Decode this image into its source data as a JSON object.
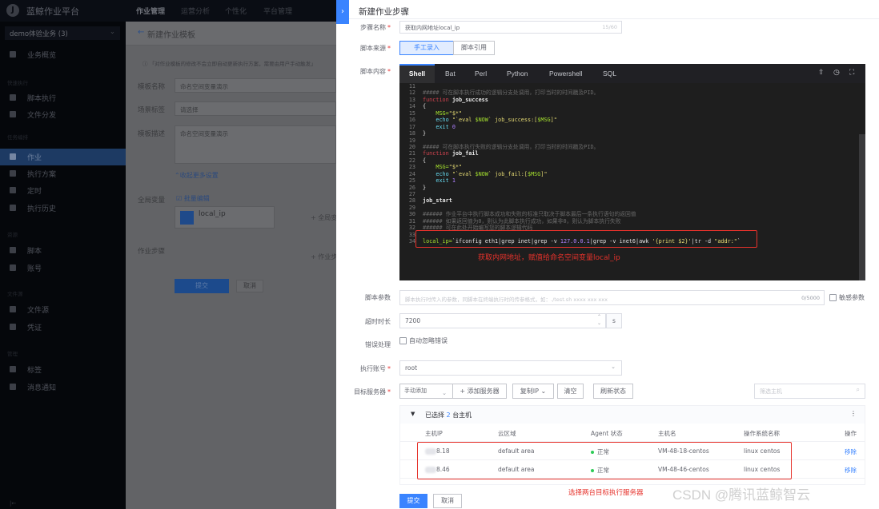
{
  "app": {
    "title": "蓝鲸作业平台",
    "logo_letter": "J",
    "top_nav": [
      "作业管理",
      "运营分析",
      "个性化",
      "平台管理"
    ],
    "business_selector": "demo体验业务 (3)"
  },
  "sidebar": {
    "items": [
      {
        "label": "业务概览"
      },
      {
        "group": "快速执行"
      },
      {
        "label": "脚本执行"
      },
      {
        "label": "文件分发"
      },
      {
        "group": "任务编排"
      },
      {
        "label": "作业",
        "active": true
      },
      {
        "label": "执行方案"
      },
      {
        "label": "定时"
      },
      {
        "label": "执行历史"
      },
      {
        "group": "资源"
      },
      {
        "label": "脚本"
      },
      {
        "label": "账号"
      },
      {
        "group": "文件源"
      },
      {
        "label": "文件源"
      },
      {
        "label": "凭证"
      },
      {
        "group": "管理"
      },
      {
        "label": "标签"
      },
      {
        "label": "消息通知"
      }
    ],
    "collapse_icon": "collapse-icon"
  },
  "background_page": {
    "title": "新建作业模板",
    "tip": "「对作业模板的修改不会立即自动更新执行方案，需要由用户手动触发」",
    "template_name_label": "模板名称",
    "template_name_value": "命名空间变量演示",
    "scene_tag_label": "场景标签",
    "scene_tag_placeholder": "请选择",
    "description_label": "模板描述",
    "description_value": "命名空间变量演示",
    "collapse_more": "收起更多设置",
    "global_var_label": "全局变量",
    "batch_edit": "批量编辑",
    "variable_name": "local_ip",
    "add_global": "+ 全局变",
    "steps_label": "作业步骤",
    "add_step": "+ 作业步",
    "submit": "提交",
    "cancel": "取消"
  },
  "drawer": {
    "title": "新建作业步骤",
    "step_name_label": "步骤名称",
    "step_name_value": "获取内网地址local_ip",
    "step_name_count": "15/60",
    "script_source_label": "脚本来源",
    "script_source_options": [
      "手工录入",
      "脚本引用"
    ],
    "script_source_selected": "手工录入",
    "script_content_label": "脚本内容",
    "language_tabs": [
      "Shell",
      "Bat",
      "Perl",
      "Python",
      "Powershell",
      "SQL"
    ],
    "language_selected": "Shell",
    "editor_icons": [
      "upload-icon",
      "history-icon",
      "fullscreen-icon"
    ],
    "code_lines": [
      {
        "n": "11",
        "segs": []
      },
      {
        "n": "12",
        "segs": [
          [
            "##### 可在脚本执行成功的逻辑分支处调用，打印当时的时间戳及PID。",
            "cm"
          ]
        ]
      },
      {
        "n": "13",
        "segs": [
          [
            "function",
            "kw"
          ],
          [
            " job_success",
            "fn"
          ]
        ]
      },
      {
        "n": "14",
        "segs": [
          [
            "{",
            "pl"
          ]
        ]
      },
      {
        "n": "15",
        "segs": [
          [
            "    MSG=",
            "var"
          ],
          [
            "\"$*\"",
            "str"
          ]
        ]
      },
      {
        "n": "16",
        "segs": [
          [
            "    echo",
            "bl"
          ],
          [
            " \"`eval ",
            "str"
          ],
          [
            "$NOW",
            "var"
          ],
          [
            "` job_success:[",
            "str"
          ],
          [
            "$MSG",
            "var"
          ],
          [
            "]\"",
            "str"
          ]
        ]
      },
      {
        "n": "17",
        "segs": [
          [
            "    exit",
            "bl"
          ],
          [
            " 0",
            "num"
          ]
        ]
      },
      {
        "n": "18",
        "segs": [
          [
            "}",
            "pl"
          ]
        ]
      },
      {
        "n": "19",
        "segs": []
      },
      {
        "n": "20",
        "segs": [
          [
            "##### 可在脚本执行失败的逻辑分支处调用，打印当时的时间戳及PID。",
            "cm"
          ]
        ]
      },
      {
        "n": "21",
        "segs": [
          [
            "function",
            "kw"
          ],
          [
            " job_fail",
            "fn"
          ]
        ]
      },
      {
        "n": "22",
        "segs": [
          [
            "{",
            "pl"
          ]
        ]
      },
      {
        "n": "23",
        "segs": [
          [
            "    MSG=",
            "var"
          ],
          [
            "\"$*\"",
            "str"
          ]
        ]
      },
      {
        "n": "24",
        "segs": [
          [
            "    echo",
            "bl"
          ],
          [
            " \"`eval ",
            "str"
          ],
          [
            "$NOW",
            "var"
          ],
          [
            "` job_fail:[",
            "str"
          ],
          [
            "$MSG",
            "var"
          ],
          [
            "]\"",
            "str"
          ]
        ]
      },
      {
        "n": "25",
        "segs": [
          [
            "    exit",
            "bl"
          ],
          [
            " 1",
            "num"
          ]
        ]
      },
      {
        "n": "26",
        "segs": [
          [
            "}",
            "pl"
          ]
        ]
      },
      {
        "n": "27",
        "segs": []
      },
      {
        "n": "28",
        "segs": [
          [
            "job_start",
            "fn"
          ]
        ]
      },
      {
        "n": "29",
        "segs": []
      },
      {
        "n": "30",
        "segs": [
          [
            "###### 作业平台中执行脚本成功和失败的标准只取决于脚本最后一条执行语句的返回值",
            "cm"
          ]
        ]
      },
      {
        "n": "31",
        "segs": [
          [
            "###### 如果返回值为0，则认为此脚本执行成功，如果非0，则认为脚本执行失败",
            "cm"
          ]
        ]
      },
      {
        "n": "32",
        "segs": [
          [
            "###### 可在此处开始编写您的脚本逻辑代码",
            "cm"
          ]
        ]
      },
      {
        "n": "33",
        "segs": []
      },
      {
        "n": "34",
        "segs": [
          [
            "local_ip=",
            "var"
          ],
          [
            "`ifconfig eth1|grep inet|grep -v ",
            "pl"
          ],
          [
            "127.0.0.1",
            "num"
          ],
          [
            "|grep -v inet6|awk ",
            "pl"
          ],
          [
            "'{print $2}'",
            "str"
          ],
          [
            "|tr -d ",
            "pl"
          ],
          [
            "\"addr:\"",
            "str"
          ],
          [
            "`",
            "pl"
          ]
        ]
      }
    ],
    "annotation_code": "获取内网地址，赋值给命名空间变量local_ip",
    "script_params_label": "脚本参数",
    "script_params_placeholder": "脚本执行时传入的参数，同脚本在终端执行时的传参格式，如：./test.sh xxxx xxx xxx",
    "script_params_count": "0/5000",
    "sensitive_label": "敏感参数",
    "timeout_label": "超时时长",
    "timeout_value": "7200",
    "timeout_unit": "s",
    "error_label": "错误处理",
    "error_option": "自动忽略错误",
    "account_label": "执行账号",
    "account_value": "root",
    "target_label": "目标服务器",
    "add_mode": "手动添加",
    "add_server": "+ 添加服务器",
    "copy_ip": "复制IP",
    "clear": "清空",
    "refresh": "刷新状态",
    "host_search_placeholder": "筛选主机",
    "selected_prefix": "已选择",
    "selected_count": "2",
    "selected_suffix": "台主机",
    "host_columns": [
      "主机IP",
      "云区域",
      "Agent 状态",
      "主机名",
      "操作系统名称",
      "操作"
    ],
    "hosts": [
      {
        "ip": "8.18",
        "area": "default area",
        "status": "正常",
        "name": "VM-48-18-centos",
        "os": "linux centos",
        "action": "移除"
      },
      {
        "ip": "8.46",
        "area": "default area",
        "status": "正常",
        "name": "VM-48-46-centos",
        "os": "linux centos",
        "action": "移除"
      }
    ],
    "status_color": "#2dcb56",
    "accent_color": "#3a84ff",
    "annotation_hosts": "选择两台目标执行服务器",
    "submit": "提交",
    "cancel": "取消"
  },
  "watermark": "CSDN @腾讯蓝鲸智云"
}
